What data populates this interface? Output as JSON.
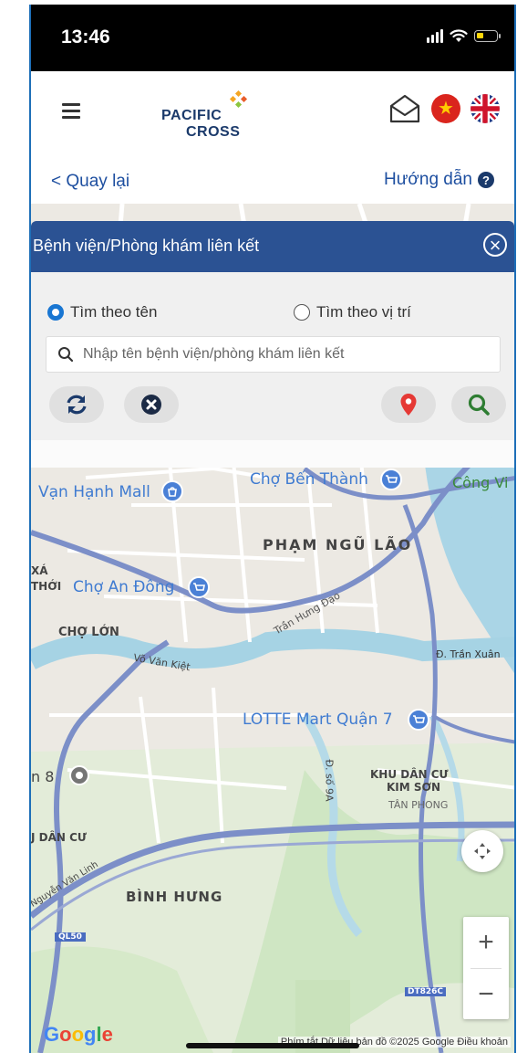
{
  "status_bar": {
    "time": "13:46"
  },
  "header": {
    "brand_line1": "PACIFIC",
    "brand_line2": "CROSS"
  },
  "nav": {
    "back_label": "< Quay lại",
    "guide_label": "Hướng dẫn"
  },
  "panel": {
    "title": "Bệnh viện/Phòng khám liên kết",
    "radio_by_name": "Tìm theo tên",
    "radio_by_location": "Tìm theo vị trí",
    "selected_mode": "Tìm theo tên",
    "search_placeholder": "Nhập tên bệnh viện/phòng khám liên kết"
  },
  "map": {
    "labels": {
      "van_hanh_mall": "Vạn Hạnh Mall",
      "cho_ben_thanh": "Chợ Bến Thành",
      "cong_vi": "Công Vi",
      "pham_ngu_lao": "PHẠM NGŨ LÃO",
      "xa": "XÁ",
      "thoi": "THỚI",
      "cho_an_dong": "Chợ An Đông",
      "tran_hung_dao": "Trần Hưng Đạo",
      "cho_lon": "CHỢ LỚN",
      "vo_van_kiet": "Võ Văn Kiệt",
      "tran_xuan": "Đ. Trần Xuân",
      "lotte": "LOTTE Mart Quận 7",
      "n8": "n 8",
      "d_so_9a": "Đ. số 9A",
      "khu_dan_cu": "KHU DÂN CƯ",
      "kim_son": "KIM SƠN",
      "tan_phong": "TÂN PHONG",
      "j_dan_cu": "J DÂN CƯ",
      "nguyen_van_linh": "Nguyễn Văn Linh",
      "binh_hung": "BÌNH HƯNG",
      "ql50": "QL50",
      "dt826c": "DT826C"
    },
    "google": "Google",
    "attribution": "Phím tắt   Dữ liệu bản đồ ©2025 Google   Điều khoản",
    "zoom_in": "+",
    "zoom_out": "−"
  },
  "colors": {
    "panel_header": "#2b5293",
    "accent_blue": "#1976d2",
    "pin_red": "#e53935",
    "search_green": "#2e7d32"
  }
}
